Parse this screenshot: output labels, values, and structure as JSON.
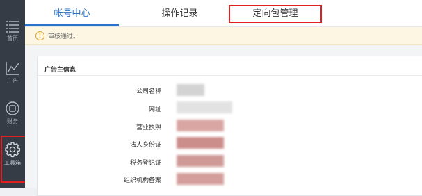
{
  "sidebar": {
    "items": [
      {
        "label": "首页",
        "icon": "menu-icon"
      },
      {
        "label": "广告",
        "icon": "line-chart-icon"
      },
      {
        "label": "财务",
        "icon": "coin-icon"
      },
      {
        "label": "工具箱",
        "icon": "gear-icon"
      }
    ]
  },
  "tabs": [
    {
      "label": "帐号中心",
      "active": true
    },
    {
      "label": "操作记录",
      "active": false
    },
    {
      "label": "定向包管理",
      "active": false
    }
  ],
  "notice": {
    "text": "审核通过。",
    "icon": "warning-icon"
  },
  "panel": {
    "title": "广告主信息",
    "fields": [
      {
        "label": "公司名称"
      },
      {
        "label": "网址"
      },
      {
        "label": "营业执照"
      },
      {
        "label": "法人身份证"
      },
      {
        "label": "税务登记证"
      },
      {
        "label": "组织机构备案"
      }
    ]
  },
  "colors": {
    "sidebar_bg": "#353c45",
    "accent": "#2a73c9",
    "highlight": "#e02020",
    "notice_bg": "#fdf6e3"
  }
}
